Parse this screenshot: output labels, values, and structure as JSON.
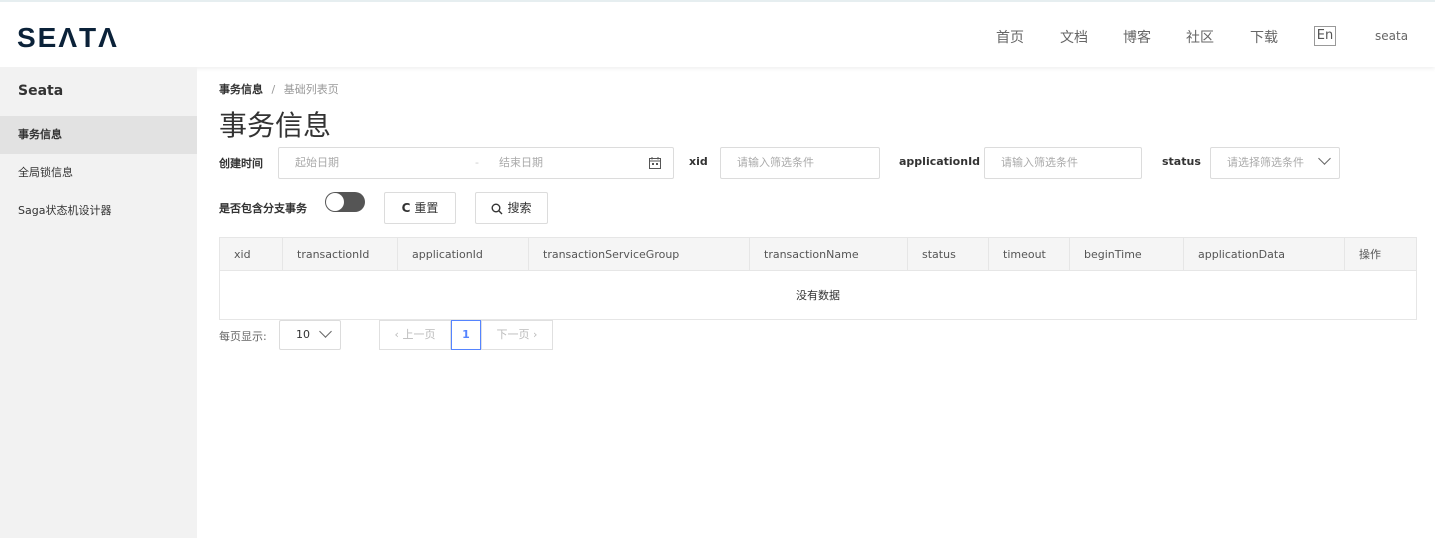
{
  "header": {
    "logo": "SEΛTΛ",
    "nav": [
      "首页",
      "文档",
      "博客",
      "社区",
      "下载"
    ],
    "lang": "En",
    "user": "seata"
  },
  "sidebar": {
    "title": "Seata",
    "items": [
      {
        "label": "事务信息",
        "active": true
      },
      {
        "label": "全局锁信息",
        "active": false
      },
      {
        "label": "Saga状态机设计器",
        "active": false
      }
    ]
  },
  "breadcrumb": {
    "current": "事务信息",
    "separator": "/",
    "page": "基础列表页"
  },
  "title": "事务信息",
  "filters": {
    "create_time_label": "创建时间",
    "start_placeholder": "起始日期",
    "range_sep": "-",
    "end_placeholder": "结束日期",
    "xid_label": "xid",
    "xid_placeholder": "请输入筛选条件",
    "app_label": "applicationId",
    "app_placeholder": "请输入筛选条件",
    "status_label": "status",
    "status_placeholder": "请选择筛选条件",
    "branch_label": "是否包含分支事务",
    "branch_on": false,
    "reset_label": "重置",
    "search_label": "搜索"
  },
  "table": {
    "columns": [
      "xid",
      "transactionId",
      "applicationId",
      "transactionServiceGroup",
      "transactionName",
      "status",
      "timeout",
      "beginTime",
      "applicationData",
      "操作"
    ],
    "empty_text": "没有数据"
  },
  "pagination": {
    "per_page_label": "每页显示:",
    "per_page": "10",
    "prev": "上一页",
    "next": "下一页",
    "current": "1"
  }
}
